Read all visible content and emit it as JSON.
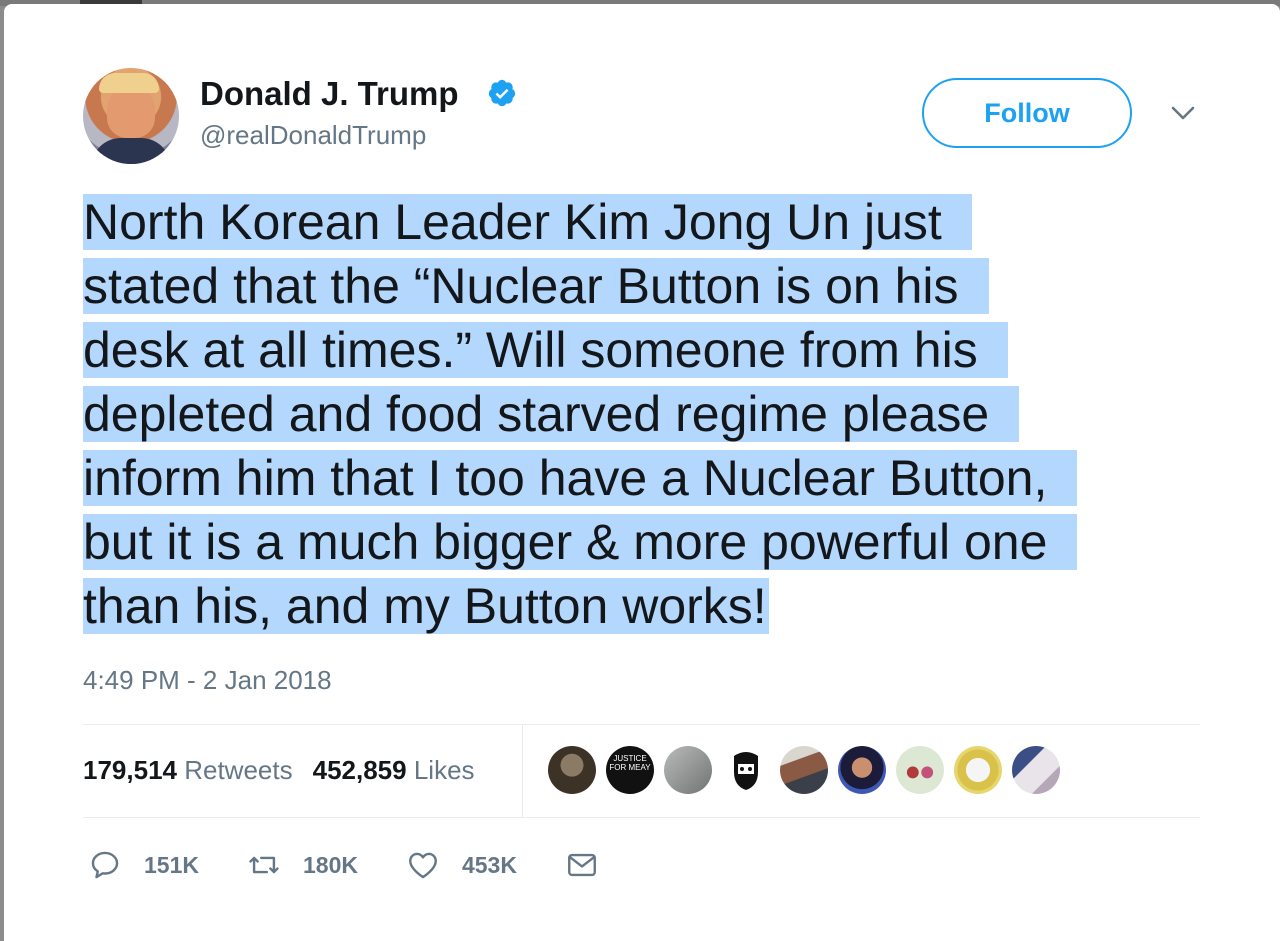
{
  "author": {
    "name": "Donald J. Trump",
    "handle": "@realDonaldTrump",
    "verified": true
  },
  "follow_button": {
    "label": "Follow"
  },
  "tweet": {
    "lines": [
      "North Korean Leader Kim Jong Un just",
      "stated that the “Nuclear Button is on his",
      "desk at all times.” Will someone from his",
      "depleted and food starved regime please",
      "inform him that I too have a Nuclear Button,",
      "but it is a much bigger & more powerful one",
      "than his, and my Button works!"
    ],
    "timestamp": "4:49 PM - 2 Jan 2018"
  },
  "stats": {
    "retweets_count": "179,514",
    "retweets_label": "Retweets",
    "likes_count": "452,859",
    "likes_label": "Likes"
  },
  "liker_avatar_text": "JUSTICE FOR MEAY",
  "actions": {
    "reply_count": "151K",
    "retweet_count": "180K",
    "like_count": "453K"
  },
  "colors": {
    "accent": "#1da1f2",
    "selection": "#b4d7fe",
    "muted": "#657786",
    "text": "#14171a"
  },
  "icons": [
    "verified-badge-icon",
    "chevron-down-icon",
    "reply-icon",
    "retweet-icon",
    "heart-icon",
    "mail-icon"
  ]
}
